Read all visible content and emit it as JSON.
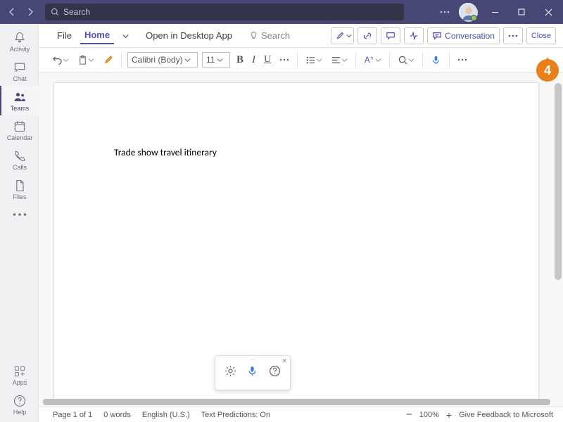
{
  "search_placeholder": "Search",
  "rail": {
    "activity": "Activity",
    "chat": "Chat",
    "teams": "Teams",
    "calendar": "Calendar",
    "calls": "Calls",
    "files": "Files",
    "apps": "Apps",
    "help": "Help"
  },
  "tabs": {
    "file": "File",
    "home": "Home",
    "open_desktop": "Open in Desktop App",
    "find": "Search",
    "conversation": "Conversation",
    "close": "Close"
  },
  "ribbon": {
    "font": "Calibri (Body)",
    "size": "11"
  },
  "doc": {
    "text": "Trade show travel itinerary"
  },
  "status": {
    "page": "Page 1 of 1",
    "words": "0 words",
    "lang": "English (U.S.)",
    "pred": "Text Predictions: On",
    "zoom": "100%",
    "feedback": "Give Feedback to Microsoft"
  },
  "callout": "4"
}
